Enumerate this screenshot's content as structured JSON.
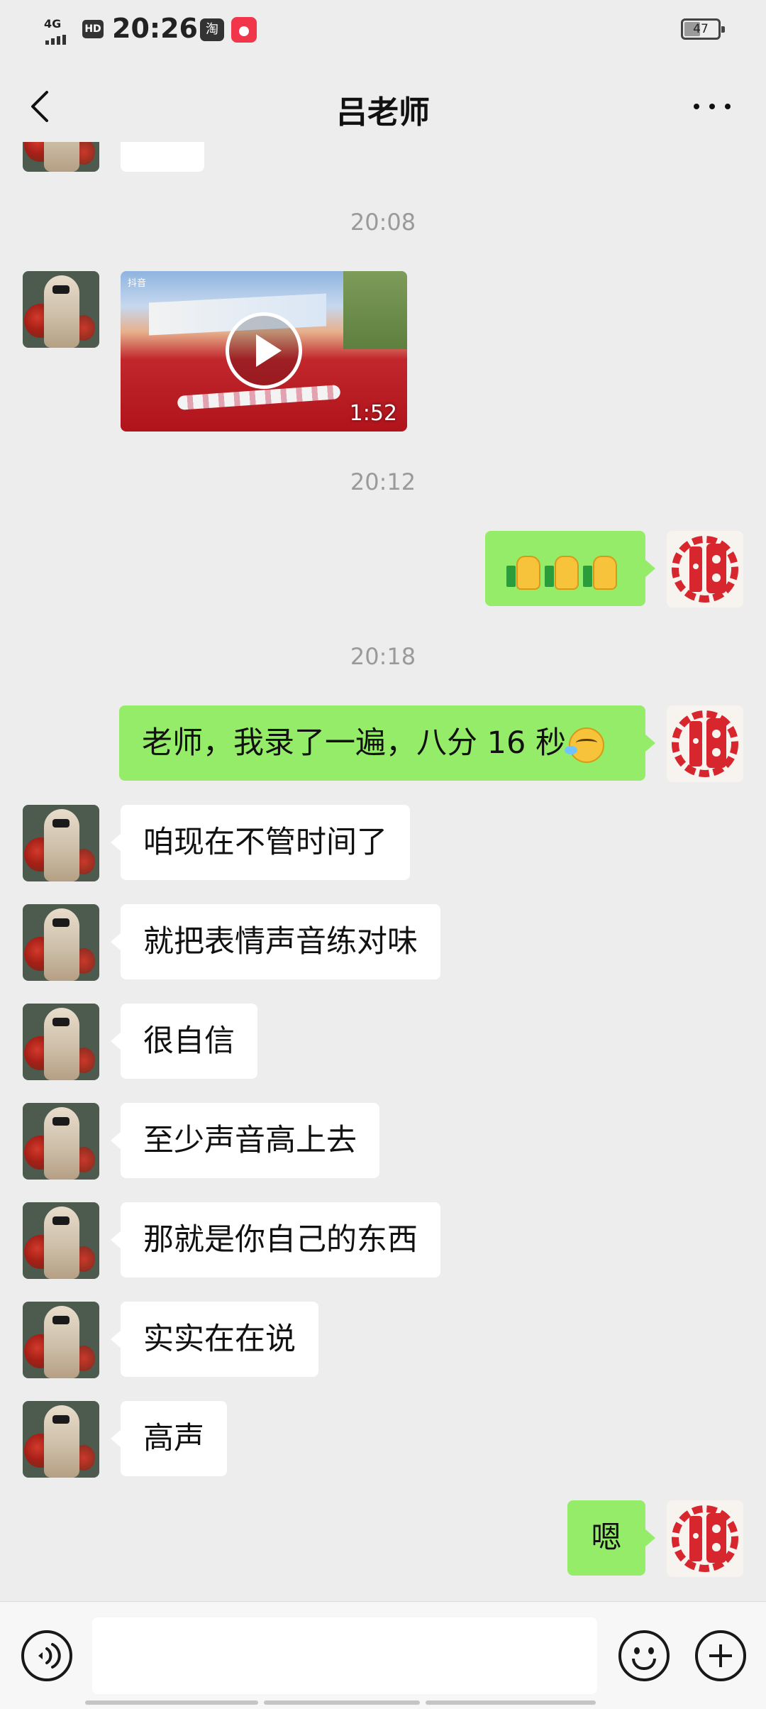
{
  "status_bar": {
    "network": "4G",
    "hd": "HD",
    "time": "20:26",
    "app1_icon": "淘",
    "battery": "47",
    "battery_level": 0.47
  },
  "nav": {
    "title": "吕老师",
    "back_icon": "chevron-left-icon",
    "more_icon": "more-icon"
  },
  "timestamps": [
    "20:08",
    "20:12",
    "20:18"
  ],
  "video": {
    "logo": "抖音",
    "duration": "1:52"
  },
  "messages": {
    "thumbs": "thumbs-up x3",
    "m1": "老师，我录了一遍，八分 16 秒",
    "m2": "咱现在不管时间了",
    "m3": "就把表情声音练对味",
    "m4": "很自信",
    "m5": "至少声音高上去",
    "m6": "那就是你自己的东西",
    "m7": "实实在在说",
    "m8": "高声",
    "m9": "嗯"
  },
  "input_bar": {
    "placeholder": "",
    "voice_icon": "voice-icon",
    "emoji_icon": "emoji-icon",
    "plus_icon": "plus-icon"
  },
  "colors": {
    "background": "#ededed",
    "bubble_self": "#95ec69",
    "bubble_other": "#ffffff",
    "timestamp": "#9a9a9a"
  }
}
